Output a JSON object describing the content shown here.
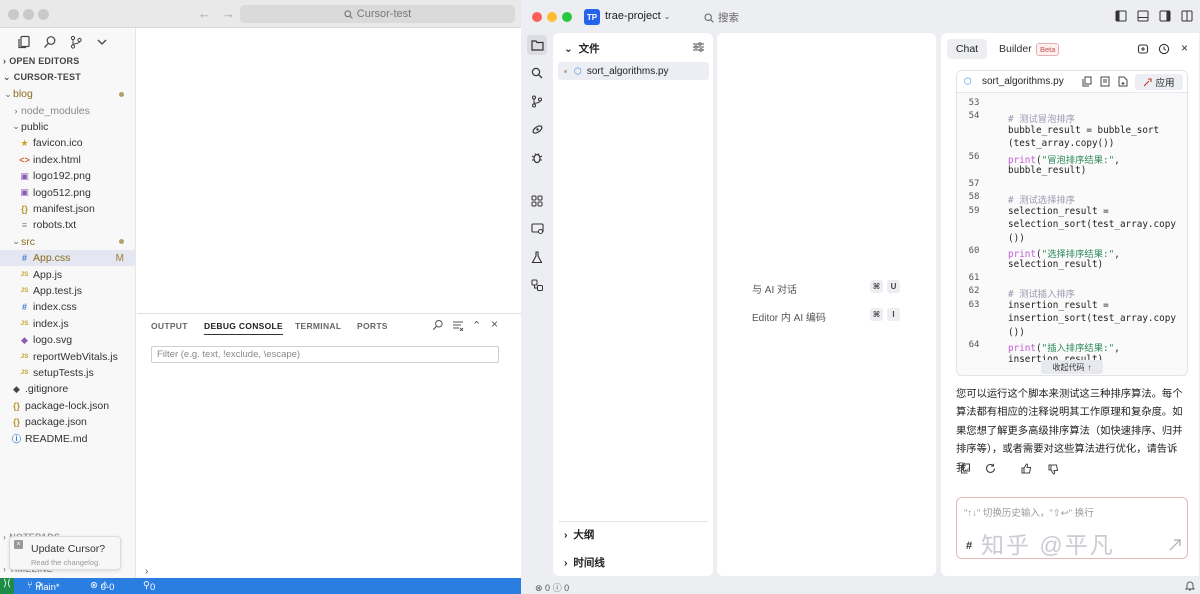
{
  "cursor": {
    "search_text": "Cursor-test",
    "sections": {
      "open_editors": "OPEN EDITORS",
      "project": "CURSOR-TEST",
      "notepads": "NOTEPADS",
      "timeline": "TIMELINE"
    },
    "tree": [
      {
        "label": "blog",
        "kind": "folder",
        "open": true,
        "indent": 0,
        "dot": true
      },
      {
        "label": "node_modules",
        "kind": "folder",
        "open": false,
        "indent": 1,
        "muted": true
      },
      {
        "label": "public",
        "kind": "folder",
        "open": true,
        "indent": 1
      },
      {
        "label": "favicon.ico",
        "kind": "star",
        "indent": 2
      },
      {
        "label": "index.html",
        "kind": "html",
        "indent": 2
      },
      {
        "label": "logo192.png",
        "kind": "img",
        "indent": 2
      },
      {
        "label": "logo512.png",
        "kind": "img",
        "indent": 2
      },
      {
        "label": "manifest.json",
        "kind": "json",
        "indent": 2
      },
      {
        "label": "robots.txt",
        "kind": "txt",
        "indent": 2
      },
      {
        "label": "src",
        "kind": "folder",
        "open": true,
        "indent": 1,
        "dot": true
      },
      {
        "label": "App.css",
        "kind": "css",
        "indent": 2,
        "selected": true,
        "badge": "M"
      },
      {
        "label": "App.js",
        "kind": "js",
        "indent": 2
      },
      {
        "label": "App.test.js",
        "kind": "js",
        "indent": 2
      },
      {
        "label": "index.css",
        "kind": "css",
        "indent": 2
      },
      {
        "label": "index.js",
        "kind": "js",
        "indent": 2
      },
      {
        "label": "logo.svg",
        "kind": "svg",
        "indent": 2
      },
      {
        "label": "reportWebVitals.js",
        "kind": "js",
        "indent": 2
      },
      {
        "label": "setupTests.js",
        "kind": "js",
        "indent": 2
      },
      {
        "label": ".gitignore",
        "kind": "git",
        "indent": 1
      },
      {
        "label": "package-lock.json",
        "kind": "json",
        "indent": 1
      },
      {
        "label": "package.json",
        "kind": "json",
        "indent": 1
      },
      {
        "label": "README.md",
        "kind": "info",
        "indent": 1
      }
    ],
    "panel_tabs": [
      "OUTPUT",
      "DEBUG CONSOLE",
      "TERMINAL",
      "PORTS"
    ],
    "active_panel_tab": "DEBUG CONSOLE",
    "filter_placeholder": "Filter (e.g. text, !exclude, \\escape)",
    "toast": {
      "title": "Update Cursor?",
      "subtitle": "Read the changelog."
    },
    "status": {
      "branch": "main*",
      "errors": "0",
      "warnings": "0",
      "ports": "0"
    }
  },
  "trae": {
    "project": "trae-project",
    "project_badge": "TP",
    "search_label": "搜索",
    "explorer": {
      "title": "文件",
      "file": "sort_algorithms.py",
      "outline": "大纲",
      "timeline": "时间线"
    },
    "shortcuts": [
      {
        "label": "与 AI 对话",
        "keys": [
          "⌘",
          "U"
        ]
      },
      {
        "label": "Editor 内 AI 编码",
        "keys": [
          "⌘",
          "I"
        ]
      }
    ],
    "chat": {
      "tab_chat": "Chat",
      "tab_builder": "Builder",
      "beta": "Beta",
      "code_file": "sort_algorithms.py",
      "apply": "应用",
      "collapse": "收起代码",
      "code_lines": [
        {
          "n": "53",
          "parts": [
            {
              "t": "",
              "c": ""
            }
          ]
        },
        {
          "n": "54",
          "parts": [
            {
              "t": "# 测试冒泡排序",
              "c": "cm"
            }
          ]
        },
        {
          "n": "",
          "parts": [
            {
              "t": "bubble_result = bubble_sort",
              "c": ""
            }
          ]
        },
        {
          "n": "",
          "parts": [
            {
              "t": "(test_array.copy())",
              "c": ""
            }
          ]
        },
        {
          "n": "56",
          "parts": [
            {
              "t": "print",
              "c": "fn"
            },
            {
              "t": "(",
              "c": ""
            },
            {
              "t": "\"冒泡排序结果:\"",
              "c": "st"
            },
            {
              "t": ",",
              "c": ""
            }
          ]
        },
        {
          "n": "",
          "parts": [
            {
              "t": "bubble_result)",
              "c": ""
            }
          ]
        },
        {
          "n": "57",
          "parts": [
            {
              "t": "",
              "c": ""
            }
          ]
        },
        {
          "n": "58",
          "parts": [
            {
              "t": "# 测试选择排序",
              "c": "cm"
            }
          ]
        },
        {
          "n": "59",
          "parts": [
            {
              "t": "selection_result =",
              "c": ""
            }
          ]
        },
        {
          "n": "",
          "parts": [
            {
              "t": "selection_sort(test_array.copy",
              "c": ""
            }
          ]
        },
        {
          "n": "",
          "parts": [
            {
              "t": "())",
              "c": ""
            }
          ]
        },
        {
          "n": "60",
          "parts": [
            {
              "t": "print",
              "c": "fn"
            },
            {
              "t": "(",
              "c": ""
            },
            {
              "t": "\"选择排序结果:\"",
              "c": "st"
            },
            {
              "t": ",",
              "c": ""
            }
          ]
        },
        {
          "n": "",
          "parts": [
            {
              "t": "selection_result)",
              "c": ""
            }
          ]
        },
        {
          "n": "61",
          "parts": [
            {
              "t": "",
              "c": ""
            }
          ]
        },
        {
          "n": "62",
          "parts": [
            {
              "t": "# 测试插入排序",
              "c": "cm"
            }
          ]
        },
        {
          "n": "63",
          "parts": [
            {
              "t": "insertion_result =",
              "c": ""
            }
          ]
        },
        {
          "n": "",
          "parts": [
            {
              "t": "insertion_sort(test_array.copy",
              "c": ""
            }
          ]
        },
        {
          "n": "",
          "parts": [
            {
              "t": "())",
              "c": ""
            }
          ]
        },
        {
          "n": "64",
          "parts": [
            {
              "t": "print",
              "c": "fn"
            },
            {
              "t": "(",
              "c": ""
            },
            {
              "t": "\"插入排序结果:\"",
              "c": "st"
            },
            {
              "t": ",",
              "c": ""
            }
          ]
        },
        {
          "n": "",
          "parts": [
            {
              "t": "insertion_result)",
              "c": ""
            }
          ]
        }
      ],
      "reply": "您可以运行这个脚本来测试这三种排序算法。每个算法都有相应的注释说明其工作原理和复杂度。如果您想了解更多高级排序算法（如快速排序、归并排序等），或者需要对这些算法进行优化，请告诉我。",
      "input_placeholder": "\"↑↓\" 切换历史输入，\"⇧↩\" 换行",
      "input_hash": "#",
      "watermark": "知乎 @平凡"
    },
    "status": {
      "errors": "0",
      "warnings": "0"
    }
  }
}
